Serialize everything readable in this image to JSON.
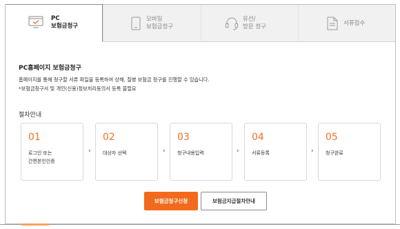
{
  "tabs": [
    {
      "line1": "PC",
      "line2": "보험금청구",
      "icon": "monitor-check-icon",
      "active": true
    },
    {
      "line1": "모바일",
      "line2": "보험금청구",
      "icon": "mobile-phone-icon",
      "active": false
    },
    {
      "line1": "유선/",
      "line2": "방문 청구",
      "icon": "headset-icon",
      "active": false
    },
    {
      "line1": "서류접수",
      "line2": "",
      "icon": "document-icon",
      "active": false
    }
  ],
  "main": {
    "heading": "PC홈페이지 보험금청구",
    "desc_line1": "홈페이지를 통해 청구할 서류 파일을 등록하여 상해, 질병 보험금 청구를 진행할 수 있습니다.",
    "desc_line2": "*보험금청구서 및 개인(신용)정보처리동의서 등록 불필요",
    "steps_heading": "절차안내"
  },
  "steps": [
    {
      "num": "01",
      "label": "로그인 또는\n간편본인인증"
    },
    {
      "num": "02",
      "label": "대상자 선택"
    },
    {
      "num": "03",
      "label": "청구내용입력"
    },
    {
      "num": "04",
      "label": "서류등록"
    },
    {
      "num": "05",
      "label": "청구완료"
    }
  ],
  "arrow_glyph": "›",
  "buttons": {
    "primary": "보험금청구신청",
    "secondary": "보험금지급절차안내"
  },
  "colors": {
    "accent": "#f37021",
    "button_primary": "#f26a1b"
  }
}
